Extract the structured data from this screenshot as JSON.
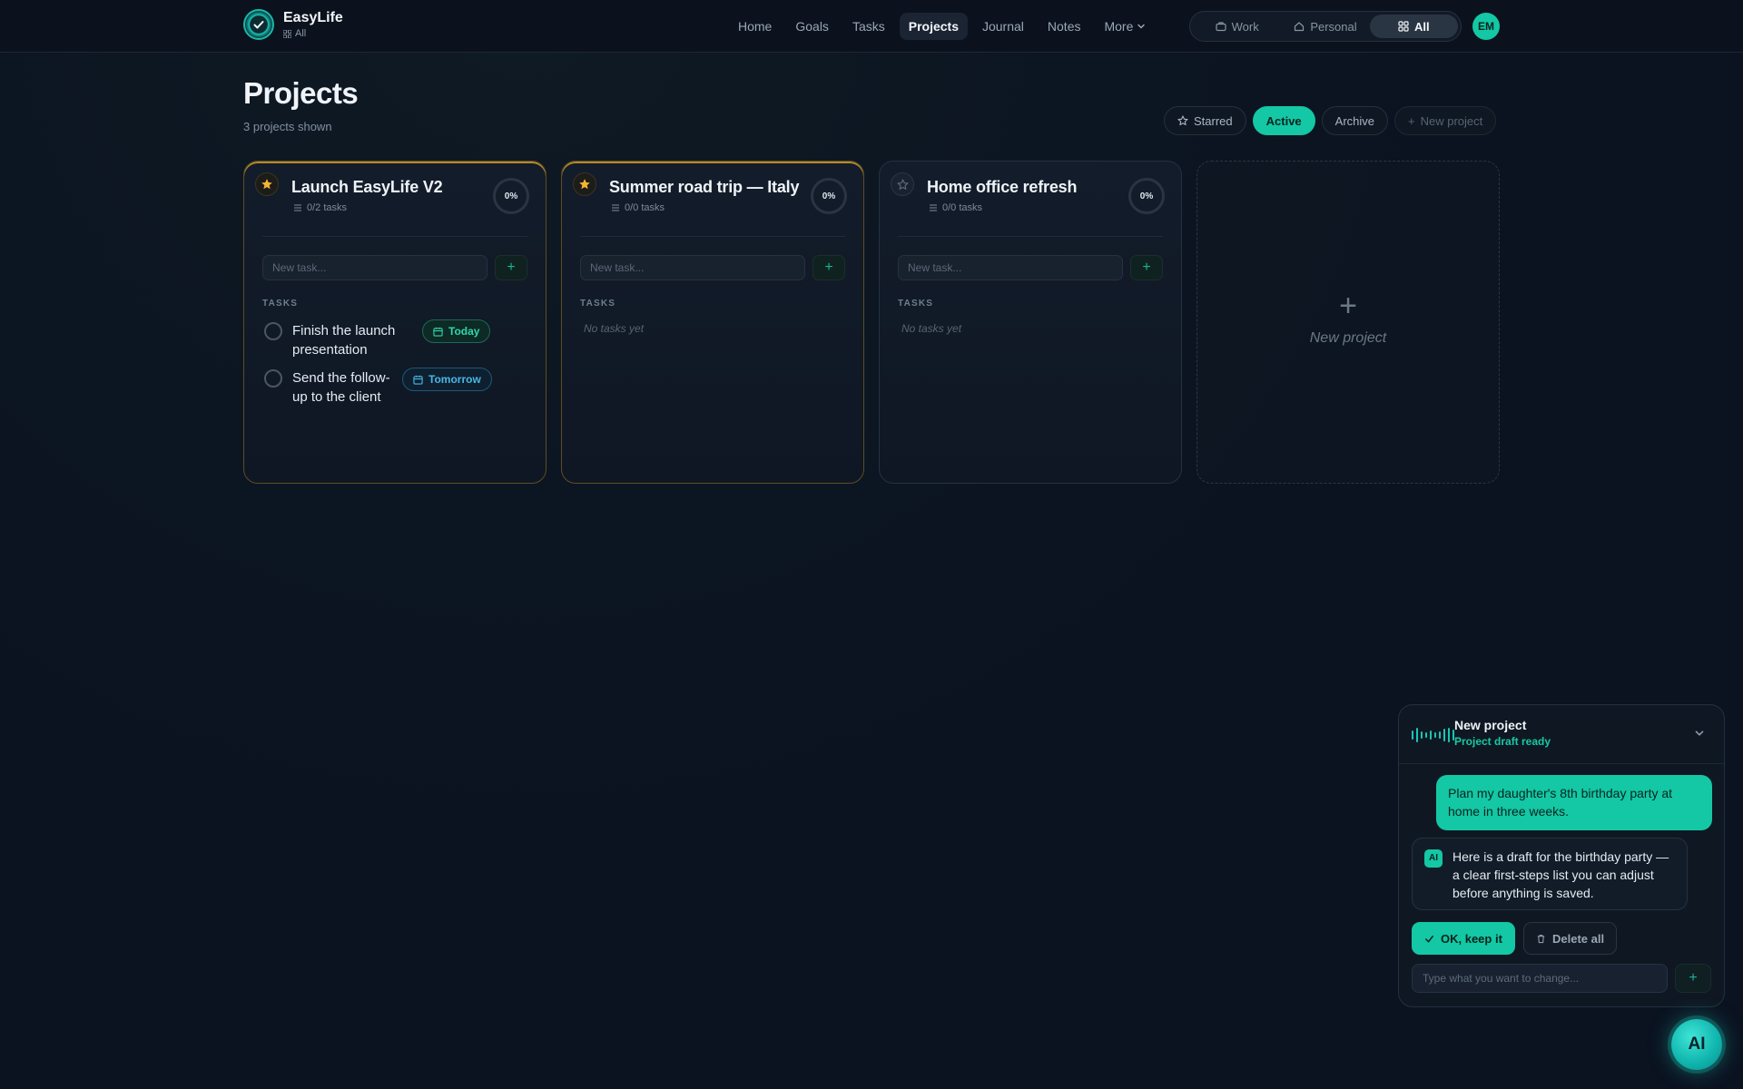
{
  "brand": {
    "name": "EasyLife",
    "scope": "All"
  },
  "nav": {
    "items": [
      "Home",
      "Goals",
      "Tasks",
      "Projects",
      "Journal",
      "Notes"
    ],
    "more": "More",
    "active": "Projects"
  },
  "modes": {
    "work": "Work",
    "personal": "Personal",
    "all": "All",
    "active": "All"
  },
  "user": {
    "initials": "EM"
  },
  "page": {
    "title": "Projects",
    "subtitle": "3 projects shown"
  },
  "filters": {
    "starred": "Starred",
    "active": "Active",
    "archive": "Archive",
    "new_project": "New project"
  },
  "projects": [
    {
      "title": "Launch EasyLife V2",
      "count": "0/2 tasks",
      "progress": "0%",
      "starred": true,
      "task_placeholder": "New task...",
      "section": "TASKS",
      "tasks": [
        {
          "text": "Finish the launch presentation",
          "due": "Today"
        },
        {
          "text": "Send the follow-up to the client",
          "due": "Tomorrow"
        }
      ]
    },
    {
      "title": "Summer road trip — Italy",
      "count": "0/0 tasks",
      "progress": "0%",
      "starred": true,
      "task_placeholder": "New task...",
      "section": "TASKS",
      "empty": "No tasks yet",
      "tasks": []
    },
    {
      "title": "Home office refresh",
      "count": "0/0 tasks",
      "progress": "0%",
      "starred": false,
      "task_placeholder": "New task...",
      "section": "TASKS",
      "empty": "No tasks yet",
      "tasks": []
    }
  ],
  "new_card": {
    "plus": "+",
    "label": "New project"
  },
  "ai_panel": {
    "title": "New project",
    "status": "Project draft ready",
    "user_message": "Plan my daughter's 8th birthday party at home in three weeks.",
    "ai_badge": "AI",
    "ai_message": "Here is a draft for the birthday party — a clear first-steps list you can adjust before anything is saved.",
    "keep_label": "OK, keep it",
    "delete_label": "Delete all",
    "input_placeholder": "Type what you want to change...",
    "send_label": "+"
  },
  "fab": {
    "label": "AI"
  },
  "colors": {
    "accent": "#14c7a5",
    "star": "#f2b632",
    "today": "#2fd7af",
    "tomorrow": "#49b6e6",
    "background": "#0b1220"
  },
  "icons": {
    "logo": "check-circle-icon",
    "scope": "grid-icon",
    "more": "chevron-down-icon",
    "work": "briefcase-icon",
    "personal": "home-icon",
    "all": "grid-icon",
    "star": "star-icon",
    "tasks": "list-icon",
    "calendar": "calendar-icon",
    "plus": "plus-icon",
    "wave": "audio-wave-icon",
    "collapse": "chevron-down-icon",
    "check": "check-icon",
    "trash": "trash-icon"
  }
}
